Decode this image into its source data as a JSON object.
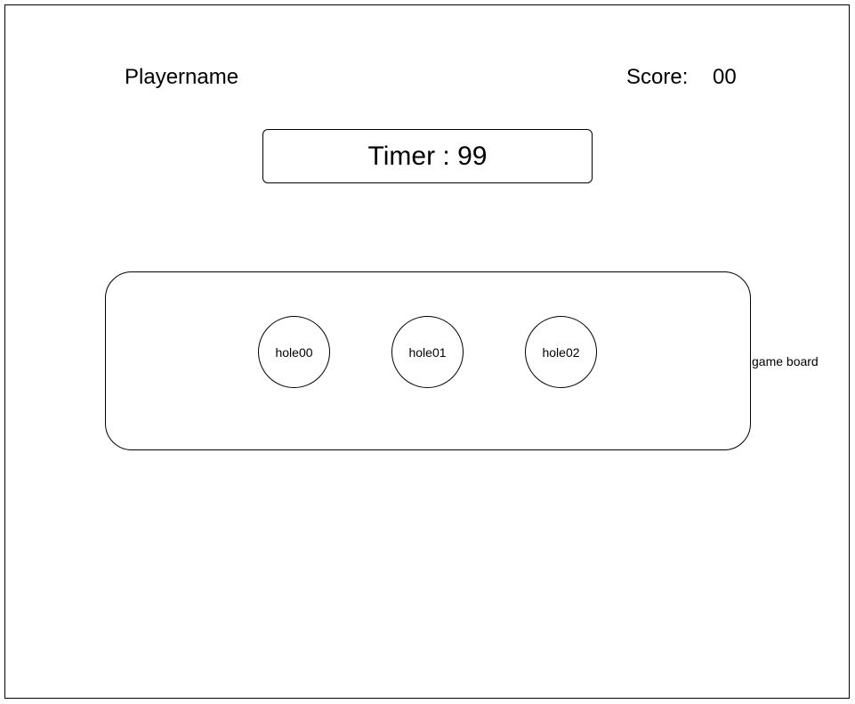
{
  "header": {
    "player_name": "Playername",
    "score_label": "Score:",
    "score_value": "00"
  },
  "timer": {
    "text": "Timer : 99"
  },
  "board": {
    "caption": "game board",
    "holes": [
      {
        "label": "hole00"
      },
      {
        "label": "hole01"
      },
      {
        "label": "hole02"
      }
    ]
  }
}
